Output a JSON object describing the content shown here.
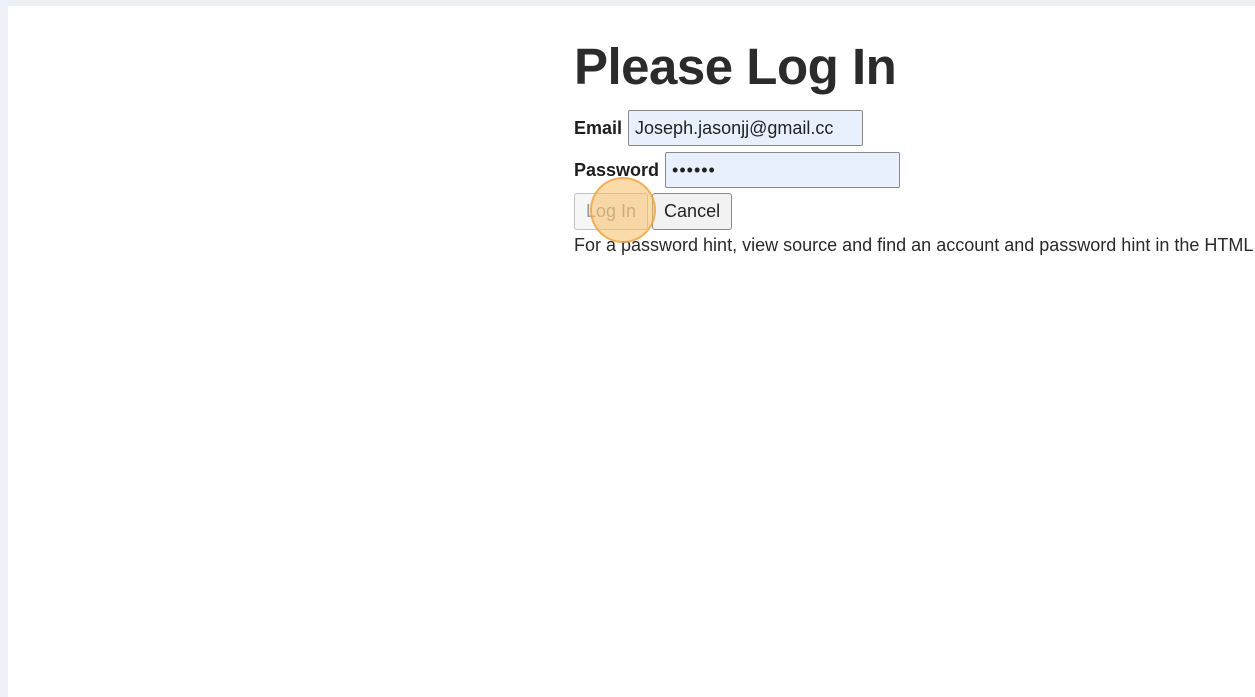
{
  "page": {
    "title": "Please Log In"
  },
  "form": {
    "email_label": "Email",
    "email_value": "Joseph.jasonjj@gmail.cc",
    "password_label": "Password",
    "password_value": "••••••",
    "login_label": "Log In",
    "cancel_label": "Cancel",
    "hint_text": "For a password hint, view source and find an account and password hint in the HTML comments."
  },
  "colors": {
    "input_autofill_bg": "#e8f0fe",
    "click_marker": "#fab864"
  }
}
